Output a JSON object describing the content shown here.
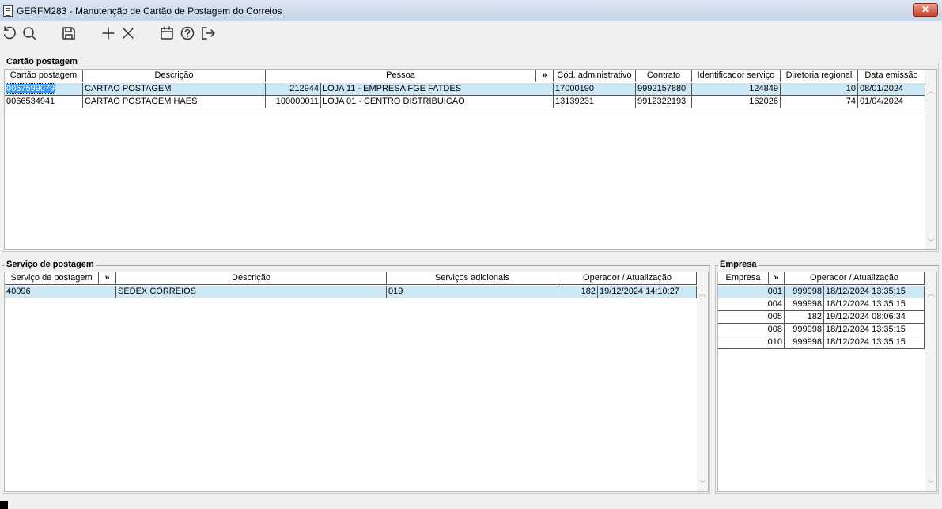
{
  "window": {
    "title": "GERFM283 - Manutenção de Cartão de Postagem do Correios",
    "close_label": "✕"
  },
  "toolbar": {
    "icons": [
      "refresh-icon",
      "search-icon",
      "save-icon",
      "add-icon",
      "delete-icon",
      "calendar-icon",
      "help-icon",
      "exit-icon"
    ]
  },
  "cartao": {
    "group_title": "Cartão postagem",
    "columns": [
      "Cartão postagem",
      "Descrição",
      "Pessoa",
      "»",
      "Cód. administrativo",
      "Contrato",
      "Identificador serviço",
      "Diretoria regional",
      "Data emissão"
    ],
    "rows": [
      {
        "cartao": "0067599079",
        "descricao": "CARTAO POSTAGEM",
        "pessoa_cod": "212944",
        "pessoa_nome": "LOJA 11 - EMPRESA FGE FATDES",
        "cod_adm": "17000190",
        "contrato": "9992157880",
        "ident": "124849",
        "diretoria": "10",
        "data": "08/01/2024"
      },
      {
        "cartao": "0066534941",
        "descricao": "CARTAO POSTAGEM HAES",
        "pessoa_cod": "100000011",
        "pessoa_nome": "LOJA 01 - CENTRO DISTRIBUICAO",
        "cod_adm": "13139231",
        "contrato": "9912322193",
        "ident": "162026",
        "diretoria": "74",
        "data": "01/04/2024"
      }
    ]
  },
  "servico": {
    "group_title": "Serviço de postagem",
    "columns": [
      "Serviço de postagem",
      "»",
      "Descrição",
      "Serviços adicionais",
      "Operador / Atualização"
    ],
    "rows": [
      {
        "codigo": "40096",
        "descricao": "SEDEX CORREIOS",
        "adicionais": "019",
        "operador": "182",
        "atualizacao": "19/12/2024 14:10:27"
      }
    ]
  },
  "empresa": {
    "group_title": "Empresa",
    "columns": [
      "Empresa",
      "»",
      "Operador / Atualização"
    ],
    "rows": [
      {
        "empresa": "001",
        "operador": "999998",
        "atualizacao": "18/12/2024 13:35:15"
      },
      {
        "empresa": "004",
        "operador": "999998",
        "atualizacao": "18/12/2024 13:35:15"
      },
      {
        "empresa": "005",
        "operador": "182",
        "atualizacao": "19/12/2024 08:06:34"
      },
      {
        "empresa": "008",
        "operador": "999998",
        "atualizacao": "18/12/2024 13:35:15"
      },
      {
        "empresa": "010",
        "operador": "999998",
        "atualizacao": "18/12/2024 13:35:15"
      }
    ]
  },
  "colors": {
    "selected_row": "#cde8f5",
    "highlight": "#3399ff"
  }
}
